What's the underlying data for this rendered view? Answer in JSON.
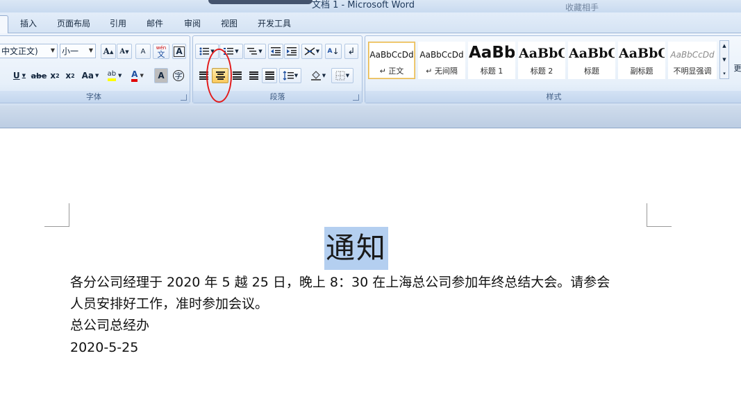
{
  "window": {
    "title": "文档 1 - Microsoft Word",
    "right_blur_text": "收藏相手"
  },
  "tabs": [
    "插入",
    "页面布局",
    "引用",
    "邮件",
    "审阅",
    "视图",
    "开发工具"
  ],
  "font_group": {
    "label": "字体",
    "font_name": "中文正文)",
    "font_size": "小一",
    "grow": "A",
    "shrink": "A",
    "clear": "A",
    "phonetic": "wén",
    "phonetic_char": "文",
    "border_char": "A",
    "underline": "U",
    "strike": "abe",
    "subscript": "x",
    "subscript_sub": "2",
    "superscript": "x",
    "superscript_sup": "2",
    "case": "Aa",
    "highlight": "ab",
    "font_color": "A",
    "shade": "A",
    "enclose": "字"
  },
  "paragraph_group": {
    "label": "段落",
    "sort": "A"
  },
  "styles_group": {
    "label": "样式",
    "items": [
      {
        "sample": "AaBbCcDd",
        "name": "↵ 正文"
      },
      {
        "sample": "AaBbCcDd",
        "name": "↵ 无间隔"
      },
      {
        "sample": "AaBb",
        "name": "标题 1"
      },
      {
        "sample": "AaBbC",
        "name": "标题 2"
      },
      {
        "sample": "AaBbC",
        "name": "标题"
      },
      {
        "sample": "AaBbC",
        "name": "副标题"
      },
      {
        "sample": "AaBbCcDd",
        "name": "不明显强调"
      }
    ],
    "more_label": "更"
  },
  "document": {
    "heading": "通知",
    "lines": [
      "各分公司经理于 2020 年 5 越 25 日，晚上 8：30 在上海总公司参加年终总结大会。请参会",
      "人员安排好工作，准时参加会议。",
      "总公司总经办",
      "2020-5-25"
    ]
  },
  "colors": {
    "highlight": "#ffff00",
    "font_color": "#e00000",
    "selection": "#b4cff0",
    "annotation": "#e21b1b"
  }
}
